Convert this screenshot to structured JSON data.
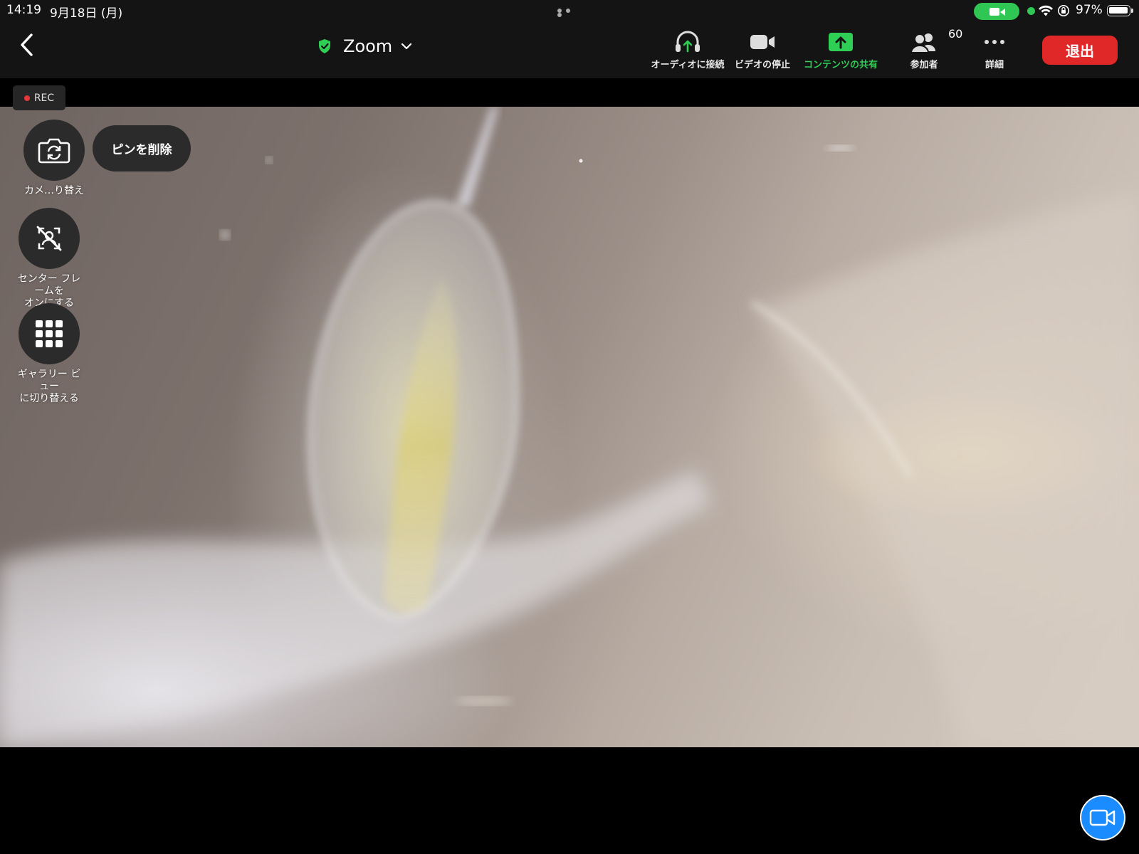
{
  "status_bar": {
    "time": "14:19",
    "date": "9月18日 (月)",
    "battery_percent": "97%",
    "icons": [
      "camera-in-use-icon",
      "wifi-icon",
      "rotation-lock-icon",
      "battery-icon"
    ]
  },
  "toolbar": {
    "meeting_title": "Zoom",
    "buttons": {
      "audio": "オーディオに接続",
      "video": "ビデオの停止",
      "share": "コンテンツの共有",
      "participants": "参加者",
      "more": "詳細"
    },
    "participant_count": "60",
    "leave_label": "退出",
    "colors": {
      "leave": "#e02828",
      "share": "#2fce55",
      "shield": "#2fce55"
    }
  },
  "video": {
    "rec_label": "REC",
    "unpin_label": "ピンを削除",
    "controls": {
      "switch_camera": "カメ…り替え",
      "center_stage": "センター フレ\nームを\nオンにする",
      "gallery_view": "ギャラリー ビ\nュー\nに切り替える"
    }
  },
  "fab": {
    "icon": "video-camera-icon",
    "color": "#1a8cff"
  }
}
